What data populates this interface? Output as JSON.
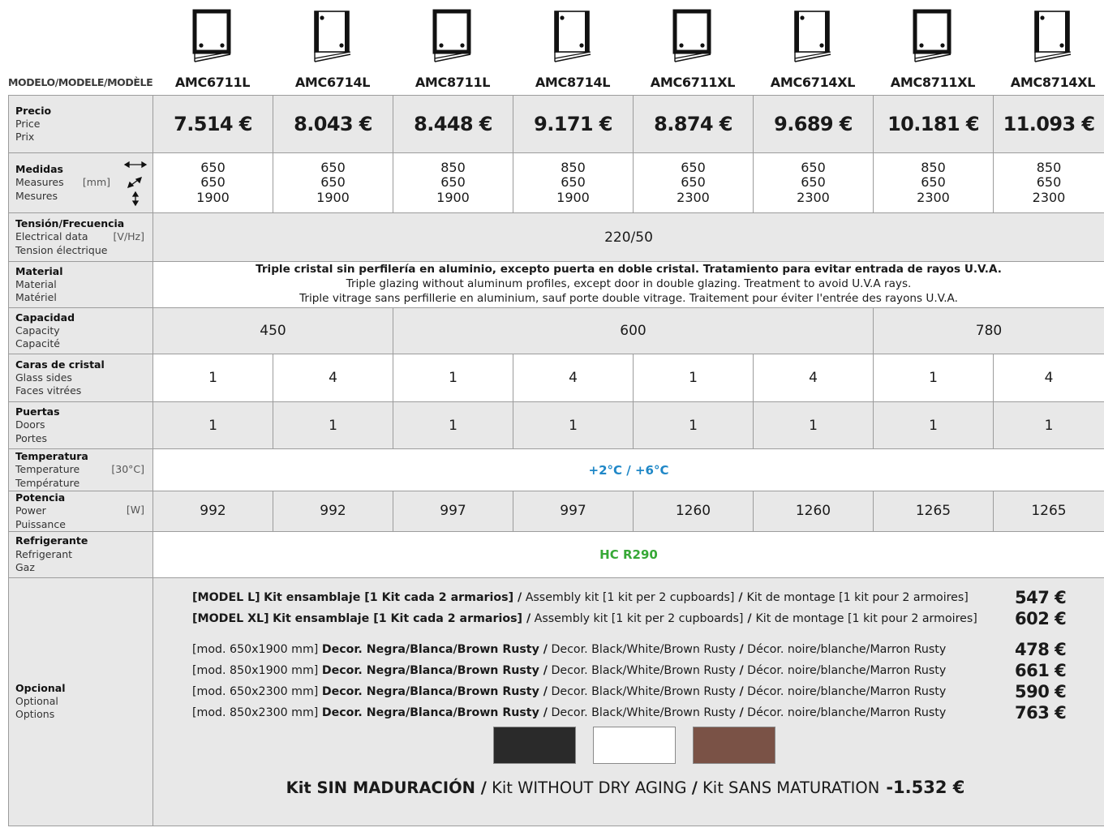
{
  "header": {
    "model_label": "MODELO/MODELE/MODÈLE",
    "models": [
      {
        "name": "AMC6711L",
        "glass_sides": "1"
      },
      {
        "name": "AMC6714L",
        "glass_sides": "4"
      },
      {
        "name": "AMC8711L",
        "glass_sides": "1"
      },
      {
        "name": "AMC8714L",
        "glass_sides": "4"
      },
      {
        "name": "AMC6711XL",
        "glass_sides": "1"
      },
      {
        "name": "AMC6714XL",
        "glass_sides": "4"
      },
      {
        "name": "AMC8711XL",
        "glass_sides": "1"
      },
      {
        "name": "AMC8714XL",
        "glass_sides": "4"
      }
    ]
  },
  "rows": {
    "price": {
      "es": "Precio",
      "en": "Price",
      "fr": "Prix",
      "values": [
        "7.514 €",
        "8.043 €",
        "8.448 €",
        "9.171 €",
        "8.874 €",
        "9.689 €",
        "10.181 €",
        "11.093 €"
      ]
    },
    "measures": {
      "es": "Medidas",
      "en": "Measures",
      "fr": "Mesures",
      "unit": "[mm]",
      "values": [
        [
          "650",
          "650",
          "1900"
        ],
        [
          "650",
          "650",
          "1900"
        ],
        [
          "850",
          "650",
          "1900"
        ],
        [
          "850",
          "650",
          "1900"
        ],
        [
          "650",
          "650",
          "2300"
        ],
        [
          "650",
          "650",
          "2300"
        ],
        [
          "850",
          "650",
          "2300"
        ],
        [
          "850",
          "650",
          "2300"
        ]
      ]
    },
    "electrical": {
      "es": "Tensión/Frecuencia",
      "en": "Electrical data",
      "fr": "Tension électrique",
      "unit": "[V/Hz]",
      "value": "220/50"
    },
    "material": {
      "es": "Material",
      "en": "Material",
      "fr": "Matériel",
      "line_es": "Triple cristal sin perfilería en aluminio, excepto puerta en doble cristal. Tratamiento para evitar entrada de rayos U.V.A.",
      "line_en": "Triple glazing without aluminum profiles, except door in double glazing. Treatment to avoid U.V.A rays.",
      "line_fr": "Triple vitrage sans perfillerie en aluminium, sauf porte double vitrage. Traitement pour éviter l'entrée des rayons U.V.A."
    },
    "capacity": {
      "es": "Capacidad",
      "en": "Capacity",
      "fr": "Capacité",
      "values": [
        "450",
        "600",
        "780"
      ]
    },
    "glass_sides": {
      "es": "Caras de cristal",
      "en": "Glass sides",
      "fr": "Faces vitrées",
      "values": [
        "1",
        "4",
        "1",
        "4",
        "1",
        "4",
        "1",
        "4"
      ]
    },
    "doors": {
      "es": "Puertas",
      "en": "Doors",
      "fr": "Portes",
      "values": [
        "1",
        "1",
        "1",
        "1",
        "1",
        "1",
        "1",
        "1"
      ]
    },
    "temperature": {
      "es": "Temperatura",
      "en": "Temperature",
      "fr": "Température",
      "unit": "[30°C]",
      "value": "+2°C / +6°C",
      "color": "#1f87c7"
    },
    "power": {
      "es": "Potencia",
      "en": "Power",
      "fr": "Puissance",
      "unit": "[W]",
      "values": [
        "992",
        "992",
        "997",
        "997",
        "1260",
        "1260",
        "1265",
        "1265"
      ]
    },
    "refrigerant": {
      "es": "Refrigerante",
      "en": "Refrigerant",
      "fr": "Gaz",
      "value": "HC R290",
      "color": "#36a836"
    }
  },
  "options": {
    "es": "Opcional",
    "en": "Optional",
    "fr": "Options",
    "kits": [
      {
        "prefix": "[MODEL L]",
        "bold": "Kit ensamblaje  [1 Kit cada 2 armarios] /",
        "normal": " Assembly kit [1 kit per 2 cupboards]",
        "sep": " / ",
        "fr": "Kit de montage [1 kit pour 2 armoires]",
        "price": "547 €"
      },
      {
        "prefix": "[MODEL XL]",
        "bold": "Kit ensamblaje  [1 Kit cada 2 armarios] /",
        "normal": " Assembly kit [1 kit per 2 cupboards]",
        "sep": " / ",
        "fr": "Kit de montage [1 kit pour 2 armoires]",
        "price": "602 €"
      }
    ],
    "decors": [
      {
        "mod": "[mod. 650x1900 mm]",
        "bold": "Decor. Negra/Blanca/Brown Rusty /",
        "en": " Decor. Black/White/Brown Rusty ",
        "sep": "/",
        "fr": " Décor. noire/blanche/Marron Rusty",
        "price": "478 €"
      },
      {
        "mod": "[mod. 850x1900 mm]",
        "bold": "Decor. Negra/Blanca/Brown Rusty /",
        "en": " Decor. Black/White/Brown Rusty ",
        "sep": "/",
        "fr": " Décor. noire/blanche/Marron Rusty",
        "price": "661 €"
      },
      {
        "mod": "[mod. 650x2300 mm]",
        "bold": "Decor. Negra/Blanca/Brown Rusty /",
        "en": " Decor. Black/White/Brown Rusty ",
        "sep": "/",
        "fr": " Décor. noire/blanche/Marron Rusty",
        "price": "590 €"
      },
      {
        "mod": "[mod. 850x2300 mm]",
        "bold": "Decor. Negra/Blanca/Brown Rusty /",
        "en": " Decor. Black/White/Brown Rusty ",
        "sep": "/",
        "fr": " Décor. noire/blanche/Marron Rusty",
        "price": "763 €"
      }
    ],
    "swatch_colors": [
      "#2a2a2a",
      "#ffffff",
      "#7a5246"
    ],
    "no_maturation": {
      "bold": "Kit SIN MADURACIÓN /",
      "en": " Kit WITHOUT DRY AGING ",
      "sep": "/",
      "fr": " Kit SANS MATURATION",
      "price": "-1.532 €"
    }
  }
}
